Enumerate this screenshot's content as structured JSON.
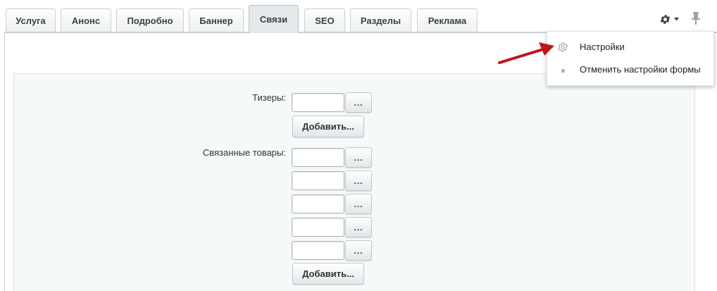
{
  "tabs": [
    {
      "label": "Услуга",
      "active": false
    },
    {
      "label": "Анонс",
      "active": false
    },
    {
      "label": "Подробно",
      "active": false
    },
    {
      "label": "Баннер",
      "active": false
    },
    {
      "label": "Связи",
      "active": true
    },
    {
      "label": "SEO",
      "active": false
    },
    {
      "label": "Разделы",
      "active": false
    },
    {
      "label": "Реклама",
      "active": false
    }
  ],
  "toolbar": {
    "settings_icon": "gear-icon",
    "pin_icon": "pin-icon"
  },
  "settings_menu": {
    "items": [
      {
        "label": "Настройки",
        "icon": "gear-icon"
      },
      {
        "label": "Отменить настройки формы",
        "icon": "bullet-icon"
      }
    ]
  },
  "form": {
    "teasers": {
      "label": "Тизеры:",
      "inputs": [
        ""
      ],
      "browse_label": "...",
      "add_label": "Добавить..."
    },
    "related_products": {
      "label": "Связанные товары:",
      "inputs": [
        "",
        "",
        "",
        "",
        ""
      ],
      "browse_label": "...",
      "add_label": "Добавить..."
    }
  },
  "colors": {
    "active_tab": "#e3e9eb",
    "form_bg": "#f5f9f9",
    "arrow": "#c0141c"
  }
}
